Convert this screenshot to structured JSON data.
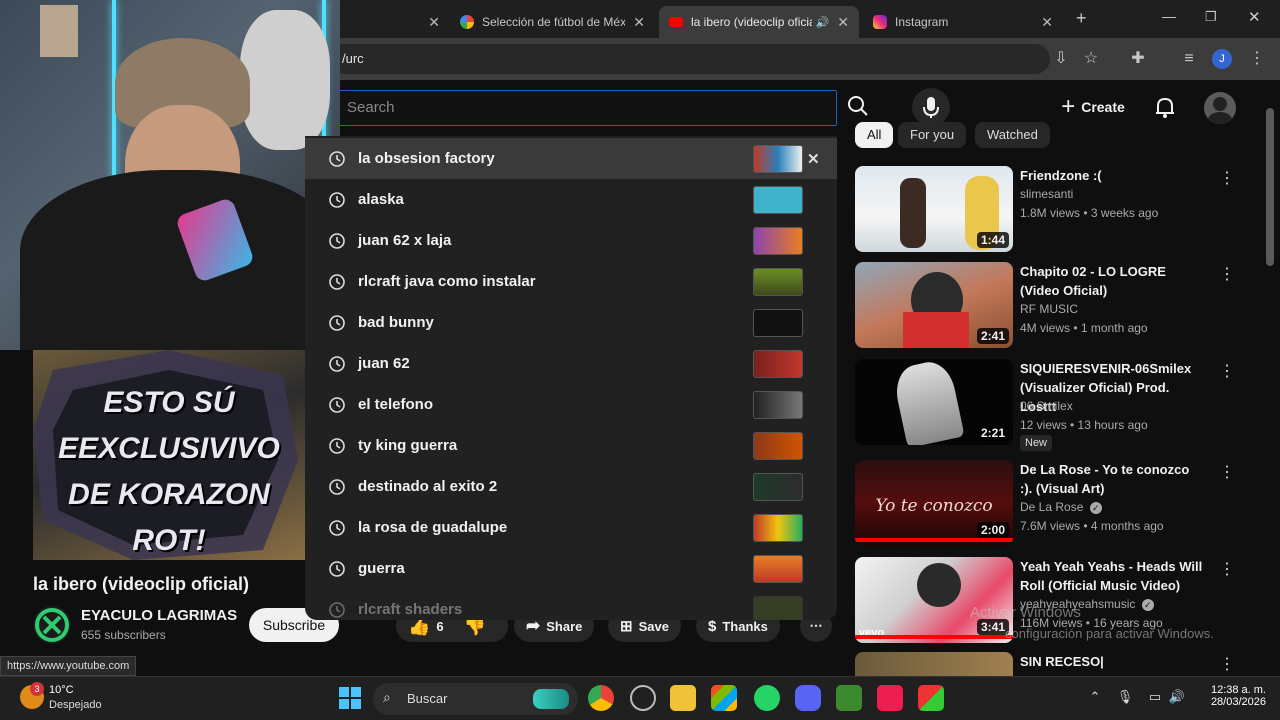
{
  "browser": {
    "tabs": [
      {
        "title": "",
        "active": false
      },
      {
        "title": "Selección de fútbol de Méx",
        "active": false,
        "favicon": "google-icon"
      },
      {
        "title": "la ibero (videoclip oficial",
        "active": true,
        "favicon": "youtube-icon"
      },
      {
        "title": "Instagram",
        "active": false,
        "favicon": "instagram-icon"
      }
    ],
    "new_tab": "+",
    "url_fragment": "/urc"
  },
  "youtube": {
    "search_placeholder": "Search",
    "create_label": "Create",
    "suggestions": [
      "la obsesion factory",
      "alaska",
      "juan 62 x laja",
      "rlcraft java como instalar",
      "bad bunny",
      "juan 62",
      "el telefono",
      "ty king guerra",
      "destinado al exito 2",
      "la rosa de guadalupe",
      "guerra",
      "rlcraft shaders"
    ],
    "chips": [
      "All",
      "For you",
      "Watched"
    ],
    "video": {
      "title": "la ibero (videoclip oficial)",
      "channel": "EYACULO LAGRIMAS",
      "subscribers": "655 subscribers",
      "subscribe_label": "Subscribe",
      "likes": "6",
      "share_label": "Share",
      "save_label": "Save",
      "thanks_label": "Thanks",
      "thumbnail_text": "ESTO SÚ EEXCLUSIVIVO DE KORAZON ROT!"
    },
    "recommendations": [
      {
        "title": "Friendzone :(",
        "channel": "slimesanti",
        "meta": "1.8M views • 3 weeks ago",
        "duration": "1:44"
      },
      {
        "title": "Chapito 02 - LO LOGRE (Video Oficial)",
        "channel": "RF MUSIC",
        "meta": "4M views • 1 month ago",
        "duration": "2:41"
      },
      {
        "title": "SIQUIERESVENIR-06Smilex (Visualizer Oficial) Prod. Losttt",
        "channel": "06 Smilex",
        "meta": "12 views • 13 hours ago",
        "duration": "2:21",
        "badge": "New"
      },
      {
        "title": "De La Rose - Yo te conozco :). (Visual Art)",
        "channel": "De La Rose",
        "meta": "7.6M views • 4 months ago",
        "duration": "2:00",
        "thumb_text": "Yo te conozco"
      },
      {
        "title": "Yeah Yeah Yeahs - Heads Will Roll (Official Music Video)",
        "channel": "yeahyeahyeahsmusic",
        "meta": "116M views • 16 years ago",
        "duration": "3:41",
        "thumb_text": "vevo"
      },
      {
        "title": "SIN RECESO| CORTOMETRAJE",
        "channel": "",
        "meta": "",
        "duration": ""
      }
    ]
  },
  "watermark": {
    "line1": "Activar Windows",
    "line2": "configuración para activar Windows."
  },
  "status_url": "https://www.youtube.com",
  "taskbar": {
    "weather_badge": "3",
    "temperature": "10°C",
    "condition": "Despejado",
    "search_label": "Buscar",
    "time": "12:38 a. m.",
    "date": "28/03/2026"
  },
  "colors": {
    "accent_blue": "#1c62b9",
    "youtube_red": "#ff0000",
    "bg": "#0f0f0f"
  }
}
